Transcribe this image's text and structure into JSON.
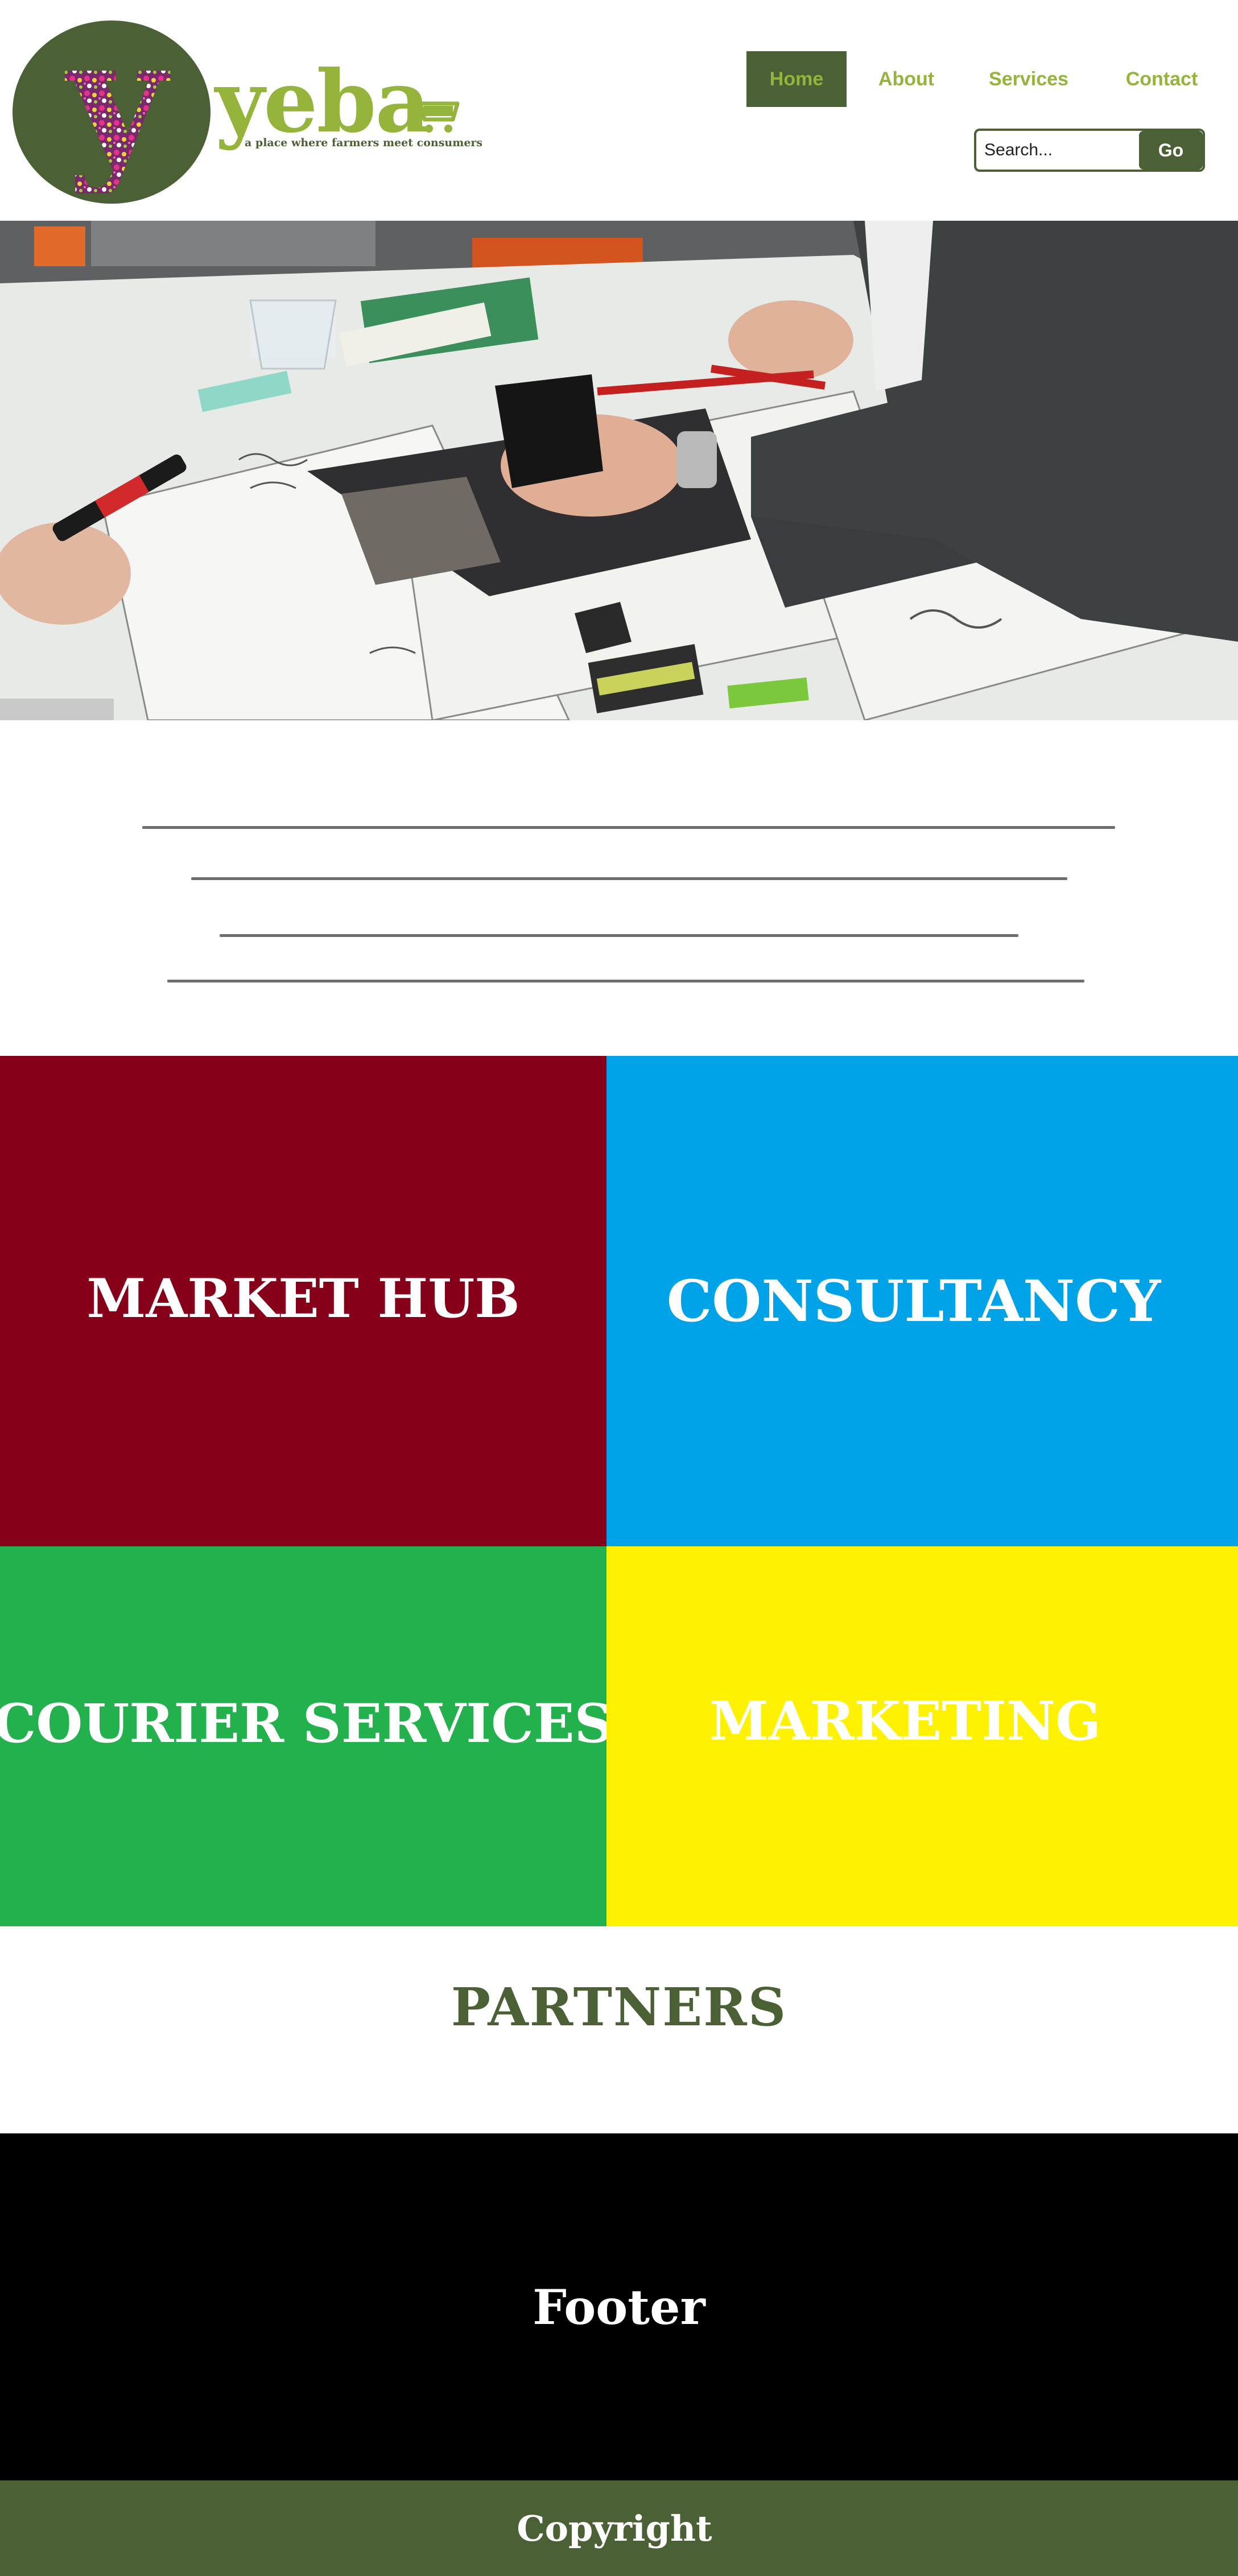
{
  "brand": {
    "name": "yeba",
    "initial": "y",
    "tagline": "a place where farmers meet consumers"
  },
  "nav": {
    "items": [
      {
        "label": "Home",
        "active": true
      },
      {
        "label": "About"
      },
      {
        "label": "Services"
      },
      {
        "label": "Contact"
      }
    ]
  },
  "search": {
    "placeholder": "Search...",
    "button_label": "Go"
  },
  "hero": {
    "image": "photo-collage-workshop"
  },
  "services": [
    {
      "label": "MARKET HUB",
      "color": "#870019"
    },
    {
      "label": "CONSULTANCY",
      "color": "#00a2e8"
    },
    {
      "label": "COURIER SERVICES",
      "color": "#22b14c"
    },
    {
      "label": "MARKETING",
      "color": "#fff200"
    }
  ],
  "partners": {
    "title": "PARTNERS"
  },
  "footer": {
    "label": "Footer"
  },
  "copyright": {
    "label": "Copyright"
  },
  "colors": {
    "brand_dark": "#4b6035",
    "brand_light": "#95b43c",
    "footer_bg": "#000000"
  }
}
